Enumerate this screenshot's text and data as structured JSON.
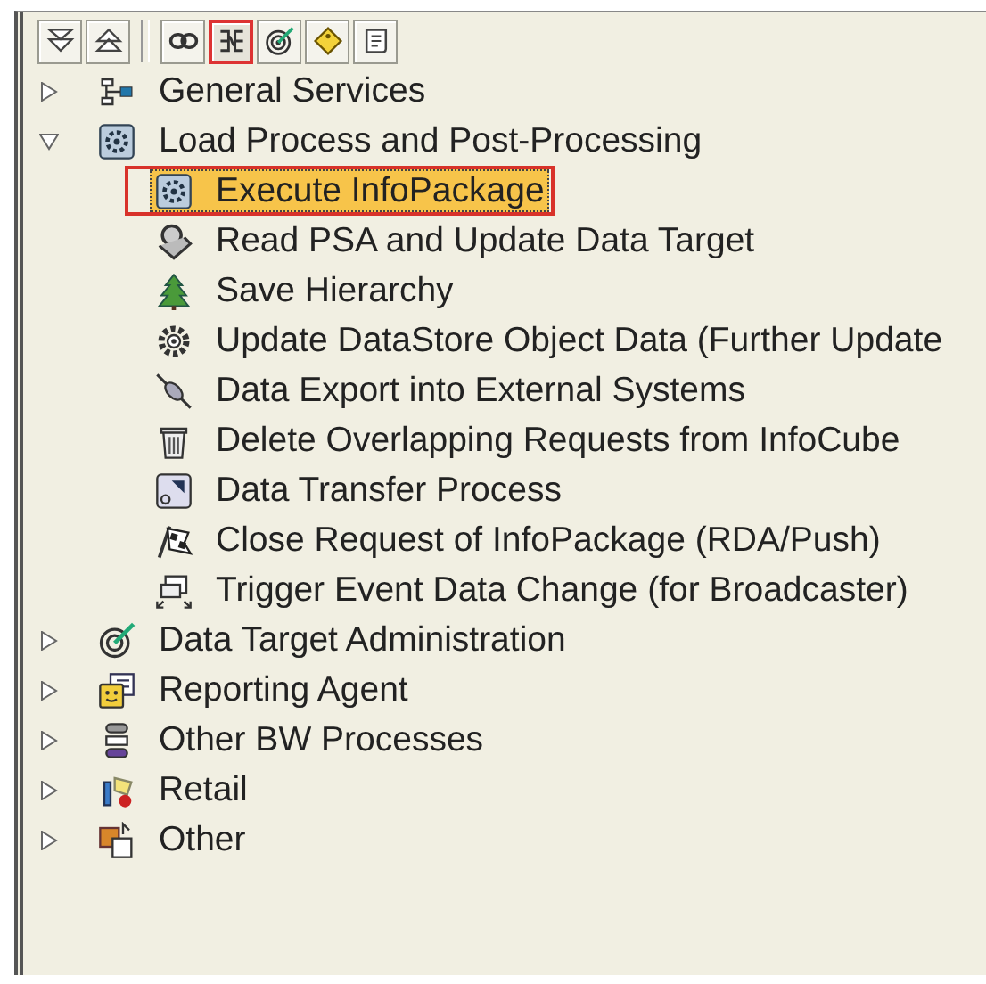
{
  "toolbar": [
    {
      "selected": false
    },
    {
      "selected": false
    },
    {
      "kind": "separator"
    },
    {
      "selected": false
    },
    {
      "selected": true
    },
    {
      "selected": false
    },
    {
      "selected": false
    },
    {
      "selected": false
    }
  ],
  "tree": [
    {
      "label": "General Services",
      "expanded": false,
      "selected": false
    },
    {
      "label": "Load Process and Post-Processing",
      "expanded": true,
      "selected": false,
      "children": [
        {
          "label": "Execute InfoPackage",
          "selected": true
        },
        {
          "label": "Read PSA and Update Data Target",
          "selected": false
        },
        {
          "label": "Save Hierarchy",
          "selected": false
        },
        {
          "label": "Update DataStore Object Data (Further Update",
          "selected": false
        },
        {
          "label": "Data Export into External Systems",
          "selected": false
        },
        {
          "label": "Delete Overlapping Requests from InfoCube",
          "selected": false
        },
        {
          "label": "Data Transfer Process",
          "selected": false
        },
        {
          "label": "Close Request of InfoPackage (RDA/Push)",
          "selected": false
        },
        {
          "label": "Trigger Event Data Change (for Broadcaster)",
          "selected": false
        }
      ]
    },
    {
      "label": "Data Target Administration",
      "expanded": false,
      "selected": false
    },
    {
      "label": "Reporting Agent",
      "expanded": false,
      "selected": false
    },
    {
      "label": "Other BW Processes",
      "expanded": false,
      "selected": false
    },
    {
      "label": "Retail",
      "expanded": false,
      "selected": false
    },
    {
      "label": "Other",
      "expanded": false,
      "selected": false
    }
  ]
}
